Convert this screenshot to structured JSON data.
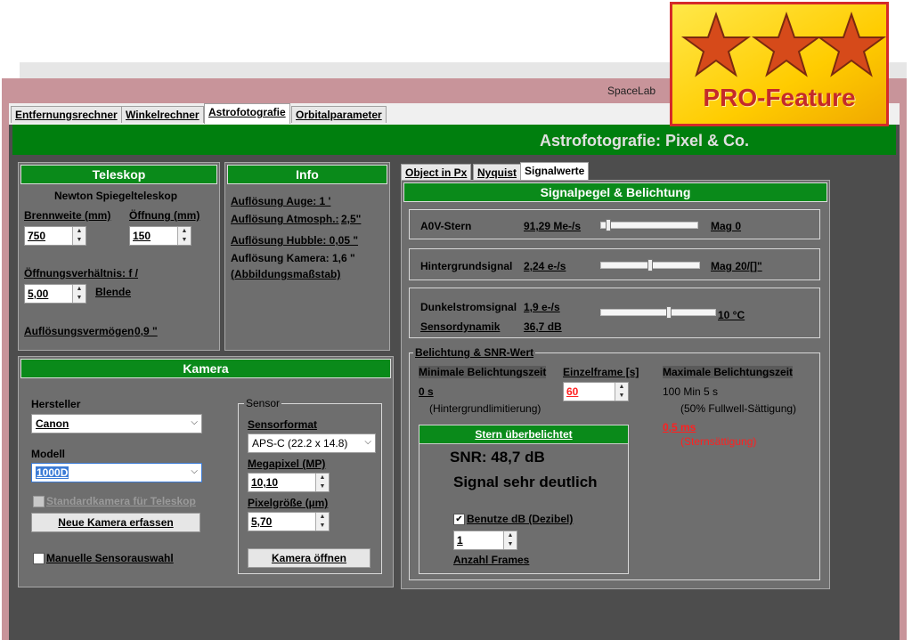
{
  "window": {
    "title": "SpaceLab"
  },
  "pro_badge": {
    "label": "PRO-Feature"
  },
  "tabs": [
    "Entfernungsrechner",
    "Winkelrechner",
    "Astrofotografie",
    "Orbitalparameter"
  ],
  "banner": {
    "title": "Astrofotografie: Pixel & Co."
  },
  "teleskop": {
    "header": "Teleskop",
    "type": "Newton Spiegelteleskop",
    "brennweite_label": "Brennweite (mm)",
    "brennweite_value": "750",
    "oeffnung_label": "Öffnung (mm)",
    "oeffnung_value": "150",
    "verhaeltnis_label": "Öffnungsverhältnis: f /",
    "verhaeltnis_value": "5,00",
    "blende_label": "Blende",
    "aufloesung_label": "Auflösungsvermögen",
    "aufloesung_value": "0,9 \""
  },
  "info": {
    "header": "Info",
    "auge": "Auflösung Auge: 1 '",
    "atmos_label": "Auflösung Atmosph.:",
    "atmos_value": "2,5\"",
    "hubble": "Auflösung Hubble: 0,05 \"",
    "kamera": "Auflösung Kamera: 1,6 \"",
    "massstab": "(Abbildungsmaßstab)"
  },
  "kamera": {
    "header": "Kamera",
    "hersteller_label": "Hersteller",
    "hersteller_value": "Canon",
    "modell_label": "Modell",
    "modell_value": "1000D",
    "standard_label": "Standardkamera für Teleskop",
    "neue_button": "Neue Kamera erfassen",
    "manuelle_label": "Manuelle Sensorauswahl",
    "sensor_legend": "Sensor",
    "sensorformat_label": "Sensorformat",
    "sensorformat_value": "APS-C (22.2 x 14.8)",
    "megapixel_label": "Megapixel (MP)",
    "megapixel_value": "10,10",
    "pixel_label": "Pixelgröße (µm)",
    "pixel_value": "5,70",
    "oeffnen_button": "Kamera öffnen"
  },
  "subtabs": [
    "Object in Px",
    "Nyquist",
    "Signalwerte"
  ],
  "signal": {
    "header": "Signalpegel & Belichtung",
    "a0v_label": "A0V-Stern",
    "a0v_value": "91,29 Me-/s",
    "a0v_mag": "Mag 0",
    "a0v_level": 0.05,
    "hg_label": "Hintergrundsignal",
    "hg_value": "2,24 e-/s",
    "hg_mag": "Mag 20/[]\"",
    "hg_level": 0.5,
    "dunkel_label": "Dunkelstromsignal",
    "dunkel_value": "1,9 e-/s",
    "dyn_label": "Sensordynamik",
    "dyn_value": "36,7 dB",
    "temp_value": "10 °C",
    "temp_level": 0.6
  },
  "belichtung": {
    "legend": "Belichtung & SNR-Wert",
    "min_label": "Minimale Belichtungszeit",
    "min_value": "0 s",
    "min_note": "(Hintergrundlimitierung)",
    "einzel_label": "Einzelframe [s]",
    "einzel_value": "60",
    "max_label": "Maximale Belichtungszeit",
    "max_value": "100 Min 5 s",
    "max_note": "(50% Fullwell-Sättigung)",
    "stern_value": "0,5 ms",
    "stern_note": "(Sternsättigung)",
    "status_header": "Stern überbelichtet",
    "snr": "SNR: 48,7 dB",
    "snr_text": "Signal sehr deutlich",
    "db_label": "Benutze dB (Dezibel)",
    "frames_value": "1",
    "frames_label": "Anzahl Frames"
  },
  "colors": {
    "green": "#007f0e",
    "window": "#c8949a",
    "panel": "#6e6e6e",
    "red": "#ff2020"
  }
}
